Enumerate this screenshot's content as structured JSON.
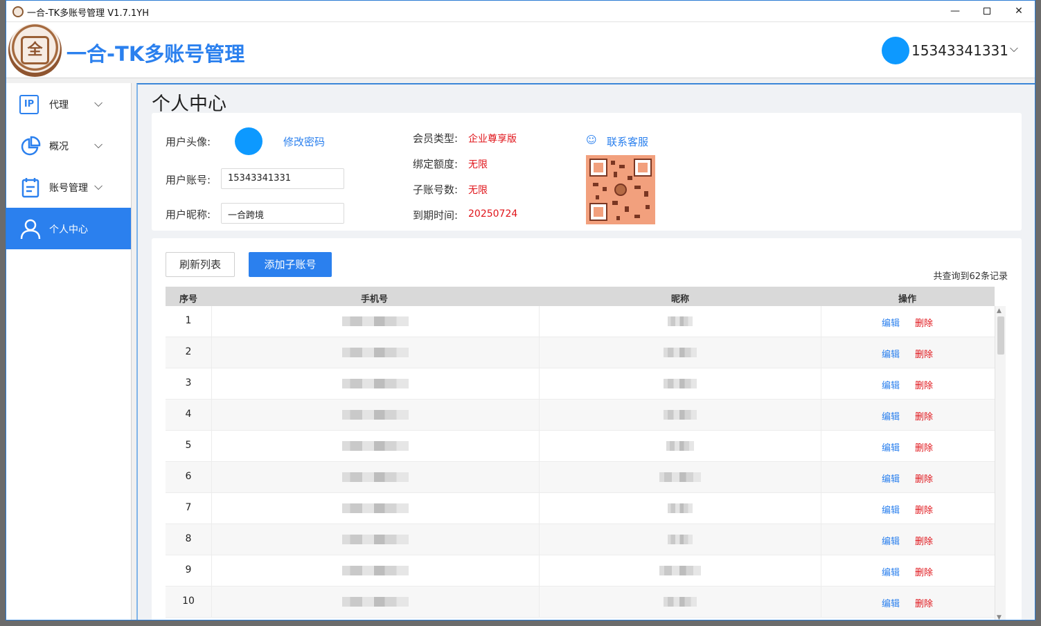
{
  "window": {
    "title": "一合-TK多账号管理 V1.7.1YH",
    "minimize_glyph": "—",
    "close_glyph": "✕"
  },
  "header": {
    "brand": "一合-TK多账号管理",
    "logo_glyph": "全",
    "user_phone": "15343341331",
    "chevron": "⌵"
  },
  "sidebar": {
    "items": [
      {
        "label": "代理",
        "icon": "ip-icon",
        "icon_text": "IP",
        "chevron": "⌵"
      },
      {
        "label": "概况",
        "icon": "pie-chart-icon",
        "chevron": "⌵"
      },
      {
        "label": "账号管理",
        "icon": "clipboard-icon",
        "chevron": "⌵"
      },
      {
        "label": "个人中心",
        "icon": "user-icon",
        "active": true
      }
    ]
  },
  "page": {
    "title": "个人中心"
  },
  "profile": {
    "avatar_label": "用户头像:",
    "change_password": "修改密码",
    "account_label": "用户账号:",
    "account_value": "15343341331",
    "nickname_label": "用户昵称:",
    "nickname_value": "一合跨境",
    "member_type_label": "会员类型:",
    "member_type_value": "企业尊享版",
    "bind_quota_label": "绑定额度:",
    "bind_quota_value": "无限",
    "sub_count_label": "子账号数:",
    "sub_count_value": "无限",
    "expire_label": "到期时间:",
    "expire_value": "20250724",
    "contact_label": "联系客服",
    "contact_icon": "☺"
  },
  "list": {
    "refresh_button": "刷新列表",
    "add_button": "添加子账号",
    "record_count": "共查询到62条记录",
    "columns": [
      "序号",
      "手机号",
      "昵称",
      "操作"
    ],
    "edit_label": "编辑",
    "delete_label": "删除",
    "rows": [
      "1",
      "2",
      "3",
      "4",
      "5",
      "6",
      "7",
      "8",
      "9",
      "10"
    ]
  },
  "colors": {
    "accent": "#2b80ee",
    "avatar": "#0d99ff",
    "danger": "#e0141a"
  }
}
